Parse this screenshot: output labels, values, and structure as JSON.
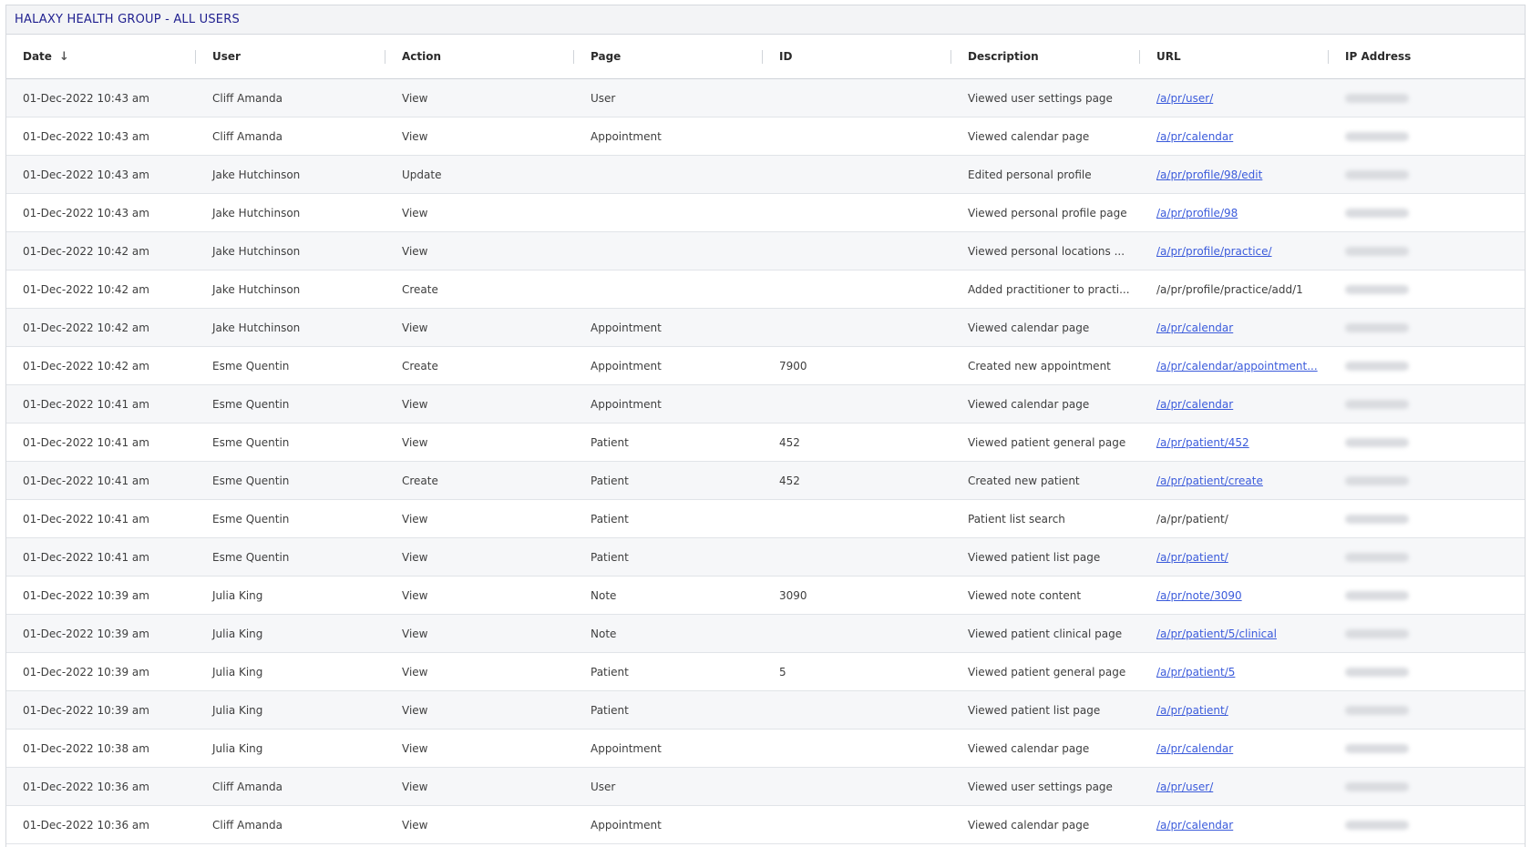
{
  "title": "HALAXY HEALTH GROUP - ALL USERS",
  "columns": [
    "Date",
    "User",
    "Action",
    "Page",
    "ID",
    "Description",
    "URL",
    "IP Address"
  ],
  "sort_icon": "arrow-down-icon",
  "rows": [
    {
      "date": "01-Dec-2022 10:43 am",
      "user": "Cliff Amanda",
      "action": "View",
      "page": "User",
      "id": "",
      "description": "Viewed user settings page",
      "url": "/a/pr/user/",
      "url_link": true
    },
    {
      "date": "01-Dec-2022 10:43 am",
      "user": "Cliff Amanda",
      "action": "View",
      "page": "Appointment",
      "id": "",
      "description": "Viewed calendar page",
      "url": "/a/pr/calendar",
      "url_link": true
    },
    {
      "date": "01-Dec-2022 10:43 am",
      "user": "Jake Hutchinson",
      "action": "Update",
      "page": "",
      "id": "",
      "description": "Edited personal profile",
      "url": "/a/pr/profile/98/edit",
      "url_link": true
    },
    {
      "date": "01-Dec-2022 10:43 am",
      "user": "Jake Hutchinson",
      "action": "View",
      "page": "",
      "id": "",
      "description": "Viewed personal profile page",
      "url": "/a/pr/profile/98",
      "url_link": true
    },
    {
      "date": "01-Dec-2022 10:42 am",
      "user": "Jake Hutchinson",
      "action": "View",
      "page": "",
      "id": "",
      "description": "Viewed personal locations ...",
      "url": "/a/pr/profile/practice/",
      "url_link": true
    },
    {
      "date": "01-Dec-2022 10:42 am",
      "user": "Jake Hutchinson",
      "action": "Create",
      "page": "",
      "id": "",
      "description": "Added practitioner to practi...",
      "url": "/a/pr/profile/practice/add/1",
      "url_link": false
    },
    {
      "date": "01-Dec-2022 10:42 am",
      "user": "Jake Hutchinson",
      "action": "View",
      "page": "Appointment",
      "id": "",
      "description": "Viewed calendar page",
      "url": "/a/pr/calendar",
      "url_link": true
    },
    {
      "date": "01-Dec-2022 10:42 am",
      "user": "Esme Quentin",
      "action": "Create",
      "page": "Appointment",
      "id": "7900",
      "description": "Created new appointment",
      "url": "/a/pr/calendar/appointment...",
      "url_link": true
    },
    {
      "date": "01-Dec-2022 10:41 am",
      "user": "Esme Quentin",
      "action": "View",
      "page": "Appointment",
      "id": "",
      "description": "Viewed calendar page",
      "url": "/a/pr/calendar",
      "url_link": true
    },
    {
      "date": "01-Dec-2022 10:41 am",
      "user": "Esme Quentin",
      "action": "View",
      "page": "Patient",
      "id": "452",
      "description": "Viewed patient general page",
      "url": "/a/pr/patient/452",
      "url_link": true
    },
    {
      "date": "01-Dec-2022 10:41 am",
      "user": "Esme Quentin",
      "action": "Create",
      "page": "Patient",
      "id": "452",
      "description": "Created new patient",
      "url": "/a/pr/patient/create",
      "url_link": true
    },
    {
      "date": "01-Dec-2022 10:41 am",
      "user": "Esme Quentin",
      "action": "View",
      "page": "Patient",
      "id": "",
      "description": "Patient list search",
      "url": "/a/pr/patient/",
      "url_link": false
    },
    {
      "date": "01-Dec-2022 10:41 am",
      "user": "Esme Quentin",
      "action": "View",
      "page": "Patient",
      "id": "",
      "description": "Viewed patient list page",
      "url": "/a/pr/patient/",
      "url_link": true
    },
    {
      "date": "01-Dec-2022 10:39 am",
      "user": "Julia King",
      "action": "View",
      "page": "Note",
      "id": "3090",
      "description": "Viewed note content",
      "url": "/a/pr/note/3090",
      "url_link": true
    },
    {
      "date": "01-Dec-2022 10:39 am",
      "user": "Julia King",
      "action": "View",
      "page": "Note",
      "id": "",
      "description": "Viewed patient clinical page",
      "url": "/a/pr/patient/5/clinical",
      "url_link": true
    },
    {
      "date": "01-Dec-2022 10:39 am",
      "user": "Julia King",
      "action": "View",
      "page": "Patient",
      "id": "5",
      "description": "Viewed patient general page",
      "url": "/a/pr/patient/5",
      "url_link": true
    },
    {
      "date": "01-Dec-2022 10:39 am",
      "user": "Julia King",
      "action": "View",
      "page": "Patient",
      "id": "",
      "description": "Viewed patient list page",
      "url": "/a/pr/patient/",
      "url_link": true
    },
    {
      "date": "01-Dec-2022 10:38 am",
      "user": "Julia King",
      "action": "View",
      "page": "Appointment",
      "id": "",
      "description": "Viewed calendar page",
      "url": "/a/pr/calendar",
      "url_link": true
    },
    {
      "date": "01-Dec-2022 10:36 am",
      "user": "Cliff Amanda",
      "action": "View",
      "page": "User",
      "id": "",
      "description": "Viewed user settings page",
      "url": "/a/pr/user/",
      "url_link": true
    },
    {
      "date": "01-Dec-2022 10:36 am",
      "user": "Cliff Amanda",
      "action": "View",
      "page": "Appointment",
      "id": "",
      "description": "Viewed calendar page",
      "url": "/a/pr/calendar",
      "url_link": true
    }
  ]
}
